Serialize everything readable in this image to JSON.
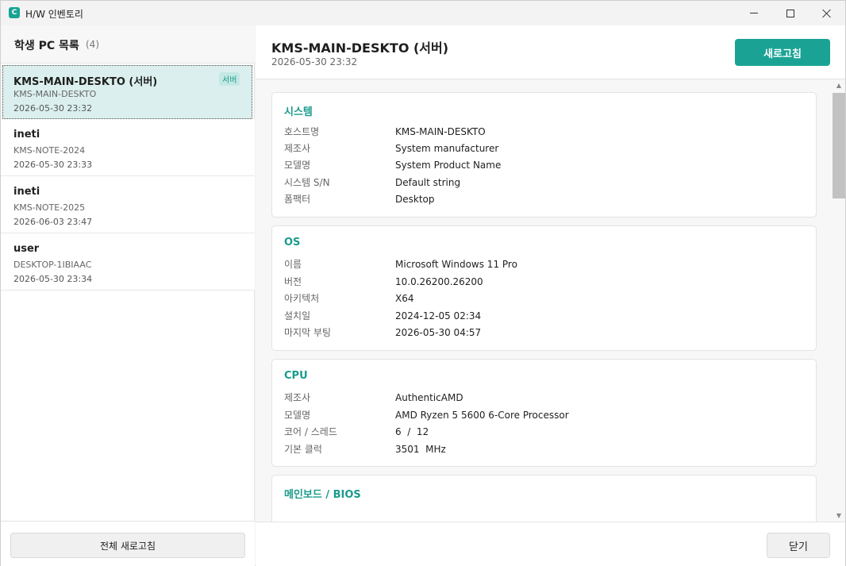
{
  "window": {
    "icon_letter": "C",
    "title": "H/W 인벤토리"
  },
  "left_panel": {
    "title": "학생 PC 목록",
    "count": "(4)",
    "items": [
      {
        "name": "KMS-MAIN-DESKTO (서버)",
        "host": "KMS-MAIN-DESKTO",
        "date": "2026-05-30 23:32",
        "badge": "서버"
      },
      {
        "name": "ineti",
        "host": "KMS-NOTE-2024",
        "date": "2026-05-30 23:33"
      },
      {
        "name": "ineti",
        "host": "KMS-NOTE-2025",
        "date": "2026-06-03 23:47"
      },
      {
        "name": "user",
        "host": "DESKTOP-1IBIAAC",
        "date": "2026-05-30 23:34"
      }
    ],
    "refresh_all_label": "전체 새로고침"
  },
  "detail": {
    "title": "KMS-MAIN-DESKTO (서버)",
    "date": "2026-05-30 23:32",
    "refresh_label": "새로고침",
    "close_label": "닫기",
    "sections": [
      {
        "title": "시스템",
        "rows": [
          {
            "label": "호스트명",
            "value": "KMS-MAIN-DESKTO"
          },
          {
            "label": "제조사",
            "value": "System manufacturer"
          },
          {
            "label": "모델명",
            "value": "System Product Name"
          },
          {
            "label": "시스템 S/N",
            "value": "Default string"
          },
          {
            "label": "폼팩터",
            "value": "Desktop"
          }
        ]
      },
      {
        "title": "OS",
        "rows": [
          {
            "label": "이름",
            "value": "Microsoft Windows 11 Pro"
          },
          {
            "label": "버전",
            "value": "10.0.26200.26200"
          },
          {
            "label": "아키텍처",
            "value": "X64"
          },
          {
            "label": "설치일",
            "value": "2024-12-05 02:34"
          },
          {
            "label": "마지막 부팅",
            "value": "2026-05-30 04:57"
          }
        ]
      },
      {
        "title": "CPU",
        "rows": [
          {
            "label": "제조사",
            "value": "AuthenticAMD"
          },
          {
            "label": "모델명",
            "value": "AMD Ryzen 5 5600 6-Core Processor"
          },
          {
            "label": "코어 / 스레드",
            "value": "6  /  12"
          },
          {
            "label": "기본 클럭",
            "value": "3501  MHz"
          }
        ]
      },
      {
        "title": "메인보드 / BIOS",
        "rows": []
      }
    ]
  }
}
